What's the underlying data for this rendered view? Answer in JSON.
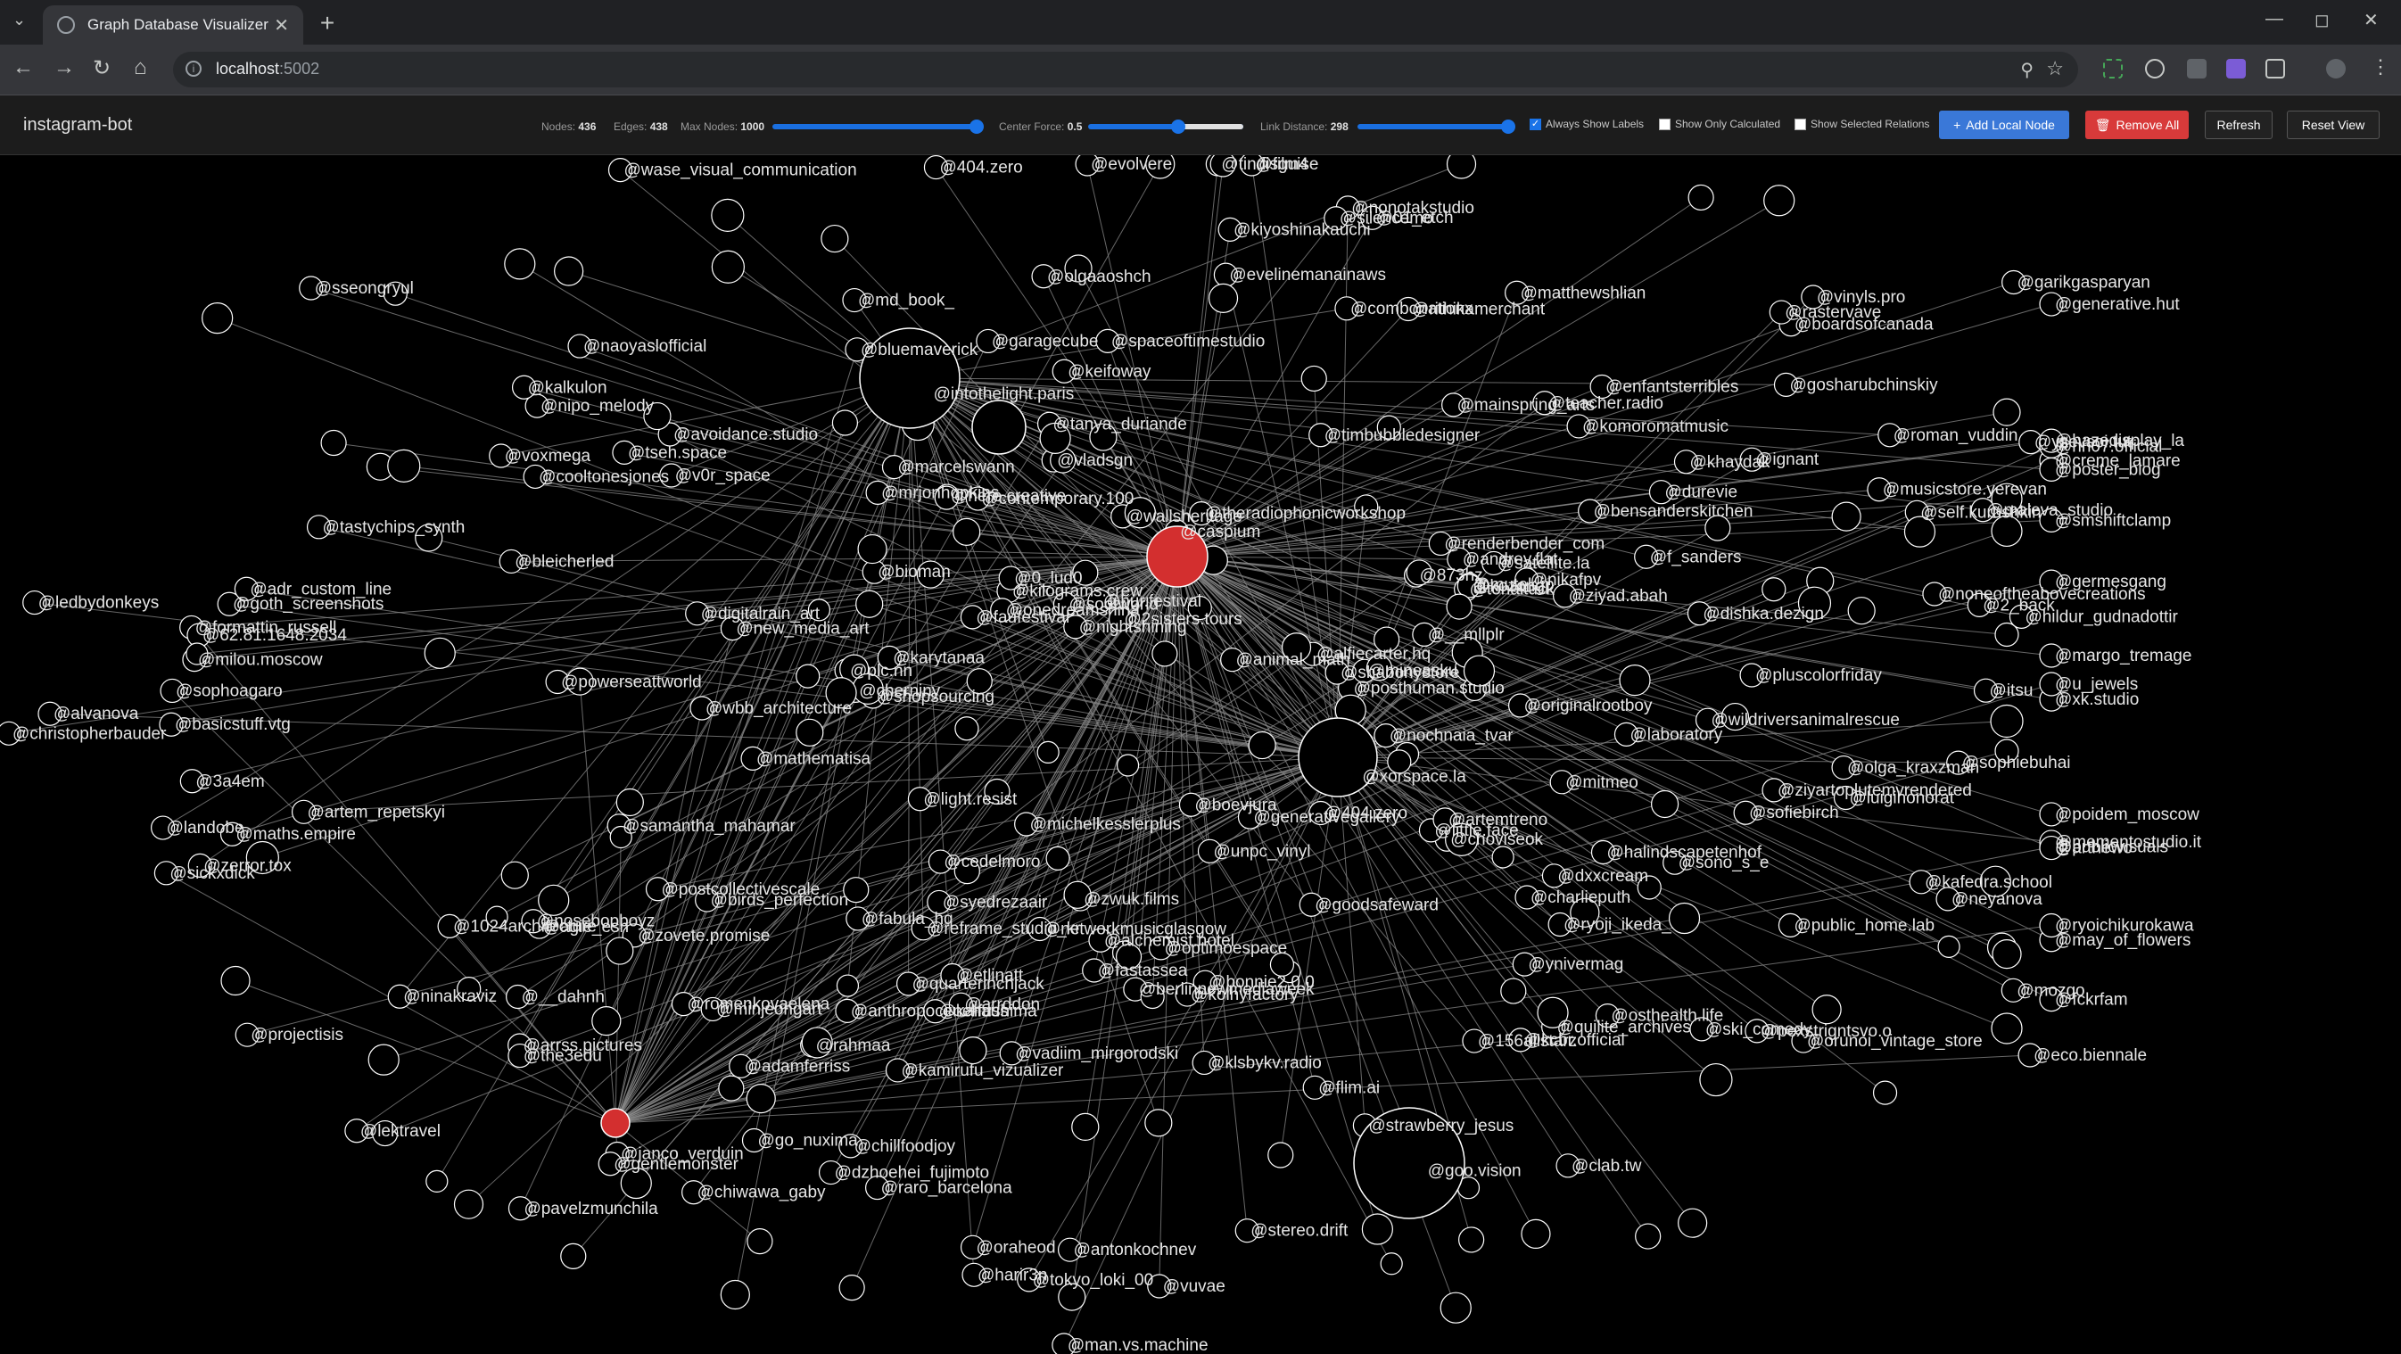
{
  "browser": {
    "tab_title": "Graph Database Visualizer",
    "url_host": "localhost",
    "url_port": ":5002"
  },
  "app": {
    "name": "instagram-bot",
    "nodes_label": "Nodes:",
    "nodes_value": "436",
    "edges_label": "Edges:",
    "edges_value": "438",
    "max_nodes_label": "Max Nodes:",
    "max_nodes_value": "1000",
    "center_force_label": "Center Force:",
    "center_force_value": "0.5",
    "link_distance_label": "Link Distance:",
    "link_distance_value": "298",
    "max_nodes_slider_fraction": 0.98,
    "center_force_slider_fraction": 0.58,
    "link_distance_slider_fraction": 0.98,
    "always_show_labels": "Always Show Labels",
    "always_show_labels_checked": true,
    "show_only_calculated": "Show Only Calculated",
    "show_only_calculated_checked": false,
    "show_selected_relations": "Show Selected Relations",
    "show_selected_relations_checked": false,
    "add_local_node": "Add Local Node",
    "remove_all": "Remove All",
    "refresh": "Refresh",
    "reset_view": "Reset View",
    "add_color": "#3a78d8",
    "remove_color": "#d83a3a"
  },
  "graph": {
    "edge_color": "#8a8a8a",
    "node_color": "#000000",
    "node_stroke": "#ffffff",
    "highlight_color": "#d32f2f",
    "labels": [
      "@eco.biennale",
      "@posthuman.studio",
      "@nochnaia_tvar",
      "@evelinemanainaws",
      "@ysevsoi.tut",
      "@reframe_studio_kr",
      "@tokyo_loki_00",
      "@originalrootboy",
      "@michelkesslerplus",
      "@alchemist.hotel",
      "@renderbender_com",
      "@ziyad.abah",
      "@creme_lamare",
      "@dzhoehei_fujimoto",
      "@wbb_architecture",
      "@f_sanders",
      "@margo_tremage",
      "@mineasku",
      "@nn07.official",
      "@cedelmoro",
      "@md_book_",
      "@optimoespace",
      "@wildriversanimalrescue",
      "@formattin_russell",
      "@cooltonesjones",
      "@arrss.pictures",
      "@chiwawa_gaby",
      "@ski_comedy",
      "@kafedra.school",
      "@clab.tw",
      "@dishka.dezign",
      "@tseh.space",
      "@choviseok",
      "@plc.nn",
      "@quilite_archives",
      "@bonnie2.0.0",
      "@karytanaa",
      "@olgaaoshch",
      "@birds_perfection",
      "@tonaltuck",
      "@ninakraviz",
      "@generative.hut",
      "@sophoagaro",
      "@contemporary.100",
      "@kamirufu_vizualizer",
      "@combonationx",
      "@vadiim_mirgorodski",
      "@raro_barcelona",
      "@osthealth.life",
      "@hur.festival",
      "@olga_kraxzman",
      "@avoidance.studio",
      "@kilograms.crew",
      "@sootworld",
      "@nonotakstudio",
      "@maleva_studio",
      "@syedrezaair",
      "@film4",
      "@rahmaa",
      "@little.face",
      "@harir3n",
      "@luigihonorat",
      "@01_etch",
      "@janco_verduin",
      "@generativegallery",
      "@roman_vuddin",
      "@satellite.la",
      "@khaydak",
      "@arrddon",
      "@matthewshlian",
      "@ignant",
      "@sseongryul",
      "@nikafpv",
      "@kiyoshinakauchi",
      "@basicstuff.vtg",
      "@zerror.tox",
      "@animal_math",
      "@ynivermag",
      "@antonkochnev",
      "@fckrfam",
      "@voxmega",
      "@artemtreno",
      "@networkmusicglasgow",
      "@charlieputh",
      "@tanya_duriande",
      "@powerseattworld",
      "@bensanderskitchen",
      "@zwuk.films",
      "@xk.studio",
      "@poidem_moscow",
      "@gosharubchinskiy",
      "@1024architecture",
      "@digitalrain_art",
      "@tastychips_synth",
      "@timbubbledesigner",
      "@2sisters.tours",
      "@vinyls.pro",
      "@durevie",
      "@bioman",
      "@ledbydonkeys",
      "@landobe",
      "@etlinatt",
      "@self.kurushkin",
      "@milou.moscow",
      "@mutek.jp",
      "@new_media_art",
      "@oraheod",
      "@neyanova",
      "@kozong",
      "@3a4em",
      "@may_of_flowers",
      "@404.zero",
      "@boevjura",
      "@christopherbauder",
      "@alvanova",
      "@quarterinchjack",
      "@sofiebirch",
      "@goth_screenshots",
      "@wallsheritage",
      "@garagecube",
      "@156allstarz",
      "@0_lud0",
      "@andrey.flat",
      "@dxxcream",
      "@lektravel",
      "@pavelzmunchila",
      "@publicvisuals",
      "@vuvae",
      "@__dahnh",
      "@2_back",
      "@v0r_space",
      "@unpc_vinyl",
      "@faufestival",
      "@laboratory",
      "@nightshining",
      "@agie_esh",
      "@spaceoftimestudio",
      "@mainspring_arts",
      "@projectisis",
      "@fastassea",
      "@62.81.1648.2034",
      "@xorspace.la",
      "@enfantsterribles",
      "@cherniny",
      "@artem_repetskyi",
      "@mitmeo",
      "@mozgo",
      "@silencemo",
      "@nipo_melody",
      "@flim.ai",
      "@404.zero",
      "@stereo.drift",
      "@tindisguise",
      "@postcollectivescale",
      "@sickxdick",
      "@poster_blog",
      "@mementostudio.it",
      "@keifoway",
      "@alfiecarter.hq",
      "@adamferriss",
      "@caspium",
      "@__mllplr",
      "@wase_visual_communication",
      "@sono_s_e",
      "@evolvere",
      "@nosebopboyz",
      "@rithikamerchant",
      "@smshiftclamp",
      "@873hz",
      "@maths.empire",
      "@goodsafeward",
      "@adr_custom_line",
      "@garikgasparyan",
      "@kaifushima",
      "@onedreamshina",
      "@kcbr.official",
      "@kalkulon",
      "@the3edu",
      "@romenkovaelena",
      "@light.resist",
      "@noneoftheabovecreations",
      "@pexstrigntsvo.o",
      "@ryoichikurokawa",
      "@gentlemonster",
      "@hazedisplay_la",
      "@vladsgn",
      "@orunoi_vintage_store",
      "@samantha_mahamar",
      "@ryoji_ikeda_",
      "@u_jewels",
      "@mathematisa",
      "@bleicherled",
      "@strawberry_jesus",
      "@chillfoodjoy",
      "@kolhyfactory",
      "@arthewo",
      "@marcelswann",
      "@goo.vision",
      "@man.vs.machine",
      "@klsbykv.radio",
      "@go_nuxima",
      "@sophiebuhai",
      "@theradiophonicworkshop",
      "@here.creative",
      "@shabonystore",
      "@zovete.promise",
      "@berlinnewmediaweek",
      "@minjeongart",
      "@itsu",
      "@boardsofcanada",
      "@bluemaverick",
      "@mrjonhopkins",
      "@musicstore.yerevan",
      "@germesgang",
      "@naoyaslofficial",
      "@pluscolorfriday",
      "@shopsourcing",
      "@teacher.radio",
      "@intothelight.paris",
      "@rastervave",
      "@komoromatmusic",
      "@fabula_hq",
      "@anthropocenehaus",
      "@halindscapetenhof",
      "@ziyartoplutemvrendered",
      "@hildur_gudnadottir",
      "@public_home.lab"
    ]
  }
}
